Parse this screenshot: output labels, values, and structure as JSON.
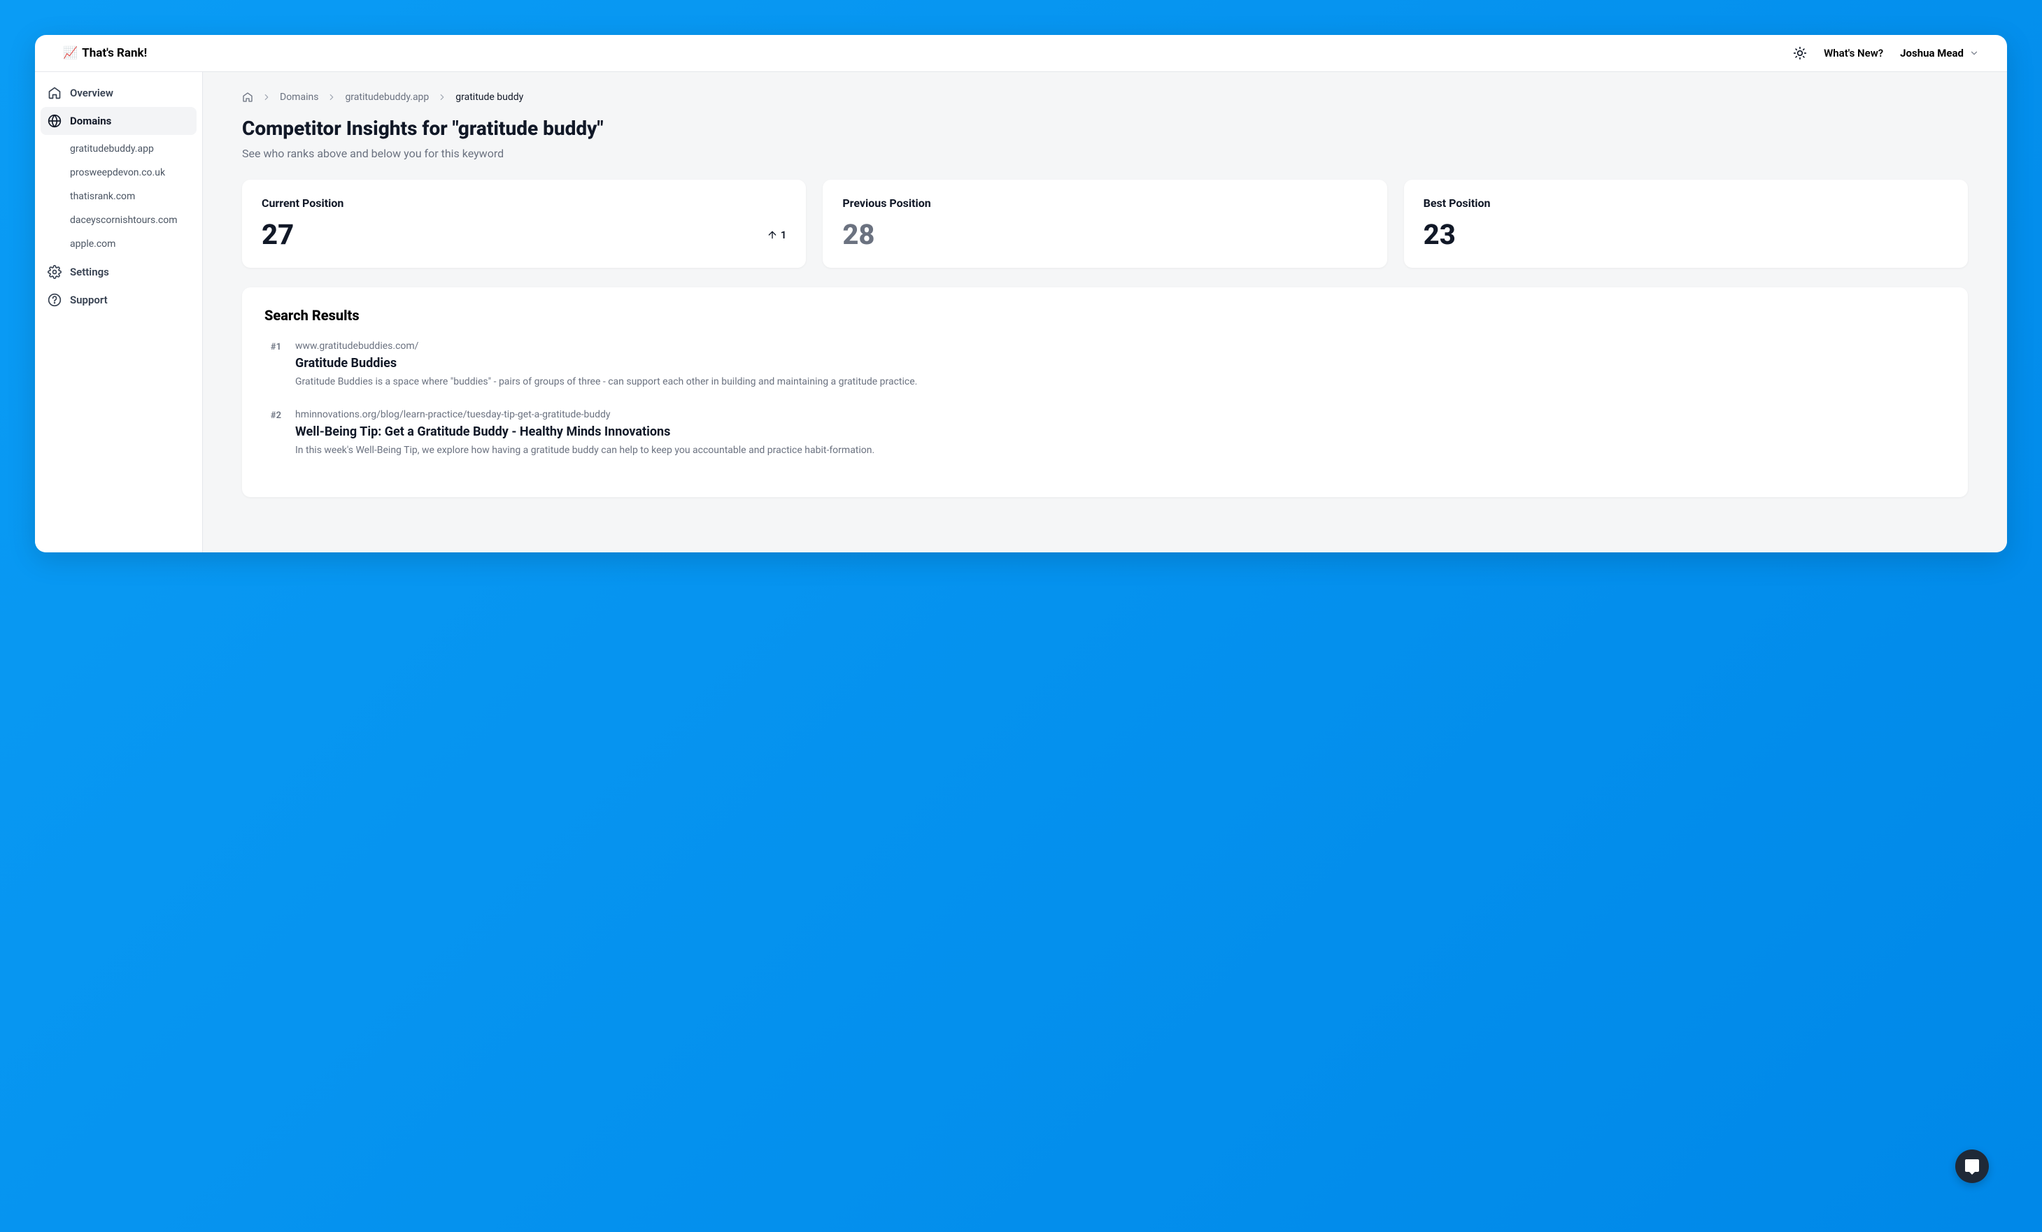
{
  "brand": {
    "emoji": "📈",
    "name": "That's Rank!"
  },
  "topbar": {
    "whats_new": "What's New?",
    "user_name": "Joshua Mead"
  },
  "sidebar": {
    "items": [
      {
        "label": "Overview"
      },
      {
        "label": "Domains"
      },
      {
        "label": "Settings"
      },
      {
        "label": "Support"
      }
    ],
    "domains": [
      "gratitudebuddy.app",
      "prosweepdevon.co.uk",
      "thatisrank.com",
      "daceyscornishtours.com",
      "apple.com"
    ]
  },
  "breadcrumb": {
    "domains": "Domains",
    "domain": "gratitudebuddy.app",
    "keyword": "gratitude buddy"
  },
  "page": {
    "title": "Competitor Insights for \"gratitude buddy\"",
    "subtitle": "See who ranks above and below you for this keyword"
  },
  "stats": {
    "current_label": "Current Position",
    "current_value": "27",
    "delta": "1",
    "previous_label": "Previous Position",
    "previous_value": "28",
    "best_label": "Best Position",
    "best_value": "23"
  },
  "results": {
    "title": "Search Results",
    "items": [
      {
        "rank": "#1",
        "url": "www.gratitudebuddies.com/",
        "title": "Gratitude Buddies",
        "desc": "Gratitude Buddies is a space where \"buddies\" - pairs of groups of three - can support each other in building and maintaining a gratitude practice."
      },
      {
        "rank": "#2",
        "url": "hminnovations.org/blog/learn-practice/tuesday-tip-get-a-gratitude-buddy",
        "title": "Well-Being Tip: Get a Gratitude Buddy - Healthy Minds Innovations",
        "desc": "In this week's Well-Being Tip, we explore how having a gratitude buddy can help to keep you accountable and practice habit-formation."
      }
    ]
  }
}
